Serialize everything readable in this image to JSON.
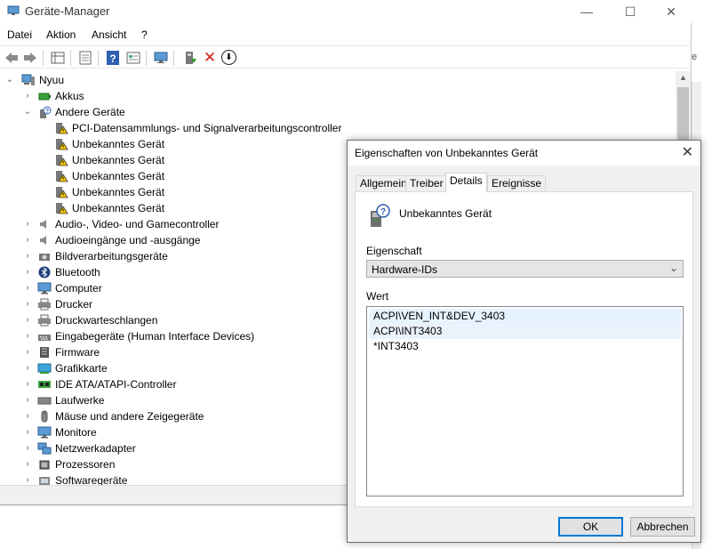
{
  "window": {
    "title": "Geräte-Manager",
    "controls": {
      "minimize": "—",
      "maximize": "☐",
      "close": "✕"
    }
  },
  "menu": [
    "Datei",
    "Aktion",
    "Ansicht",
    "?"
  ],
  "toolbar": {
    "icons": [
      "back-icon",
      "forward-icon",
      "properties-grid-icon",
      "document-icon",
      "help-icon",
      "view-icon",
      "monitor-icon",
      "enable-device-icon",
      "uninstall-icon",
      "update-driver-icon"
    ],
    "uninstall_symbol": "✕",
    "update_symbol": "⬇"
  },
  "tree": {
    "root": "Nyuu",
    "items": [
      {
        "label": "Akkus",
        "expander": "›",
        "icon": "battery-icon"
      },
      {
        "label": "Andere Geräte",
        "expander": "⌄",
        "icon": "unknown-device-icon"
      },
      {
        "label": "PCI-Datensammlungs- und Signalverarbeitungscontroller",
        "child": true,
        "icon": "warning-device-icon"
      },
      {
        "label": "Unbekanntes Gerät",
        "child": true,
        "icon": "warning-device-icon"
      },
      {
        "label": "Unbekanntes Gerät",
        "child": true,
        "icon": "warning-device-icon"
      },
      {
        "label": "Unbekanntes Gerät",
        "child": true,
        "icon": "warning-device-icon"
      },
      {
        "label": "Unbekanntes Gerät",
        "child": true,
        "icon": "warning-device-icon"
      },
      {
        "label": "Unbekanntes Gerät",
        "child": true,
        "icon": "warning-device-icon"
      },
      {
        "label": "Audio-, Video- und Gamecontroller",
        "expander": "›",
        "icon": "speaker-icon"
      },
      {
        "label": "Audioeingänge und -ausgänge",
        "expander": "›",
        "icon": "speaker-icon"
      },
      {
        "label": "Bildverarbeitungsgeräte",
        "expander": "›",
        "icon": "camera-icon"
      },
      {
        "label": "Bluetooth",
        "expander": "›",
        "icon": "bluetooth-icon"
      },
      {
        "label": "Computer",
        "expander": "›",
        "icon": "computer-icon"
      },
      {
        "label": "Drucker",
        "expander": "›",
        "icon": "printer-icon"
      },
      {
        "label": "Druckwarteschlangen",
        "expander": "›",
        "icon": "printer-icon"
      },
      {
        "label": "Eingabegeräte (Human Interface Devices)",
        "expander": "›",
        "icon": "hid-icon"
      },
      {
        "label": "Firmware",
        "expander": "›",
        "icon": "firmware-icon"
      },
      {
        "label": "Grafikkarte",
        "expander": "›",
        "icon": "display-adapter-icon"
      },
      {
        "label": "IDE ATA/ATAPI-Controller",
        "expander": "›",
        "icon": "ide-controller-icon"
      },
      {
        "label": "Laufwerke",
        "expander": "›",
        "icon": "drive-icon"
      },
      {
        "label": "Mäuse und andere Zeigegeräte",
        "expander": "›",
        "icon": "mouse-icon"
      },
      {
        "label": "Monitore",
        "expander": "›",
        "icon": "monitor-icon"
      },
      {
        "label": "Netzwerkadapter",
        "expander": "›",
        "icon": "network-icon"
      },
      {
        "label": "Prozessoren",
        "expander": "›",
        "icon": "processor-icon"
      },
      {
        "label": "Softwaregeräte",
        "expander": "›",
        "icon": "software-device-icon"
      }
    ]
  },
  "dialog": {
    "title": "Eigenschaften von Unbekanntes Gerät",
    "close": "✕",
    "tabs": [
      "Allgemein",
      "Treiber",
      "Details",
      "Ereignisse"
    ],
    "active_tab": "Details",
    "device_name": "Unbekanntes Gerät",
    "property_label": "Eigenschaft",
    "property_value": "Hardware-IDs",
    "value_label": "Wert",
    "values": [
      "ACPI\\VEN_INT&DEV_3403",
      "ACPI\\INT3403",
      "*INT3403"
    ],
    "ok": "OK",
    "cancel": "Abbrechen"
  },
  "side_text": "e"
}
